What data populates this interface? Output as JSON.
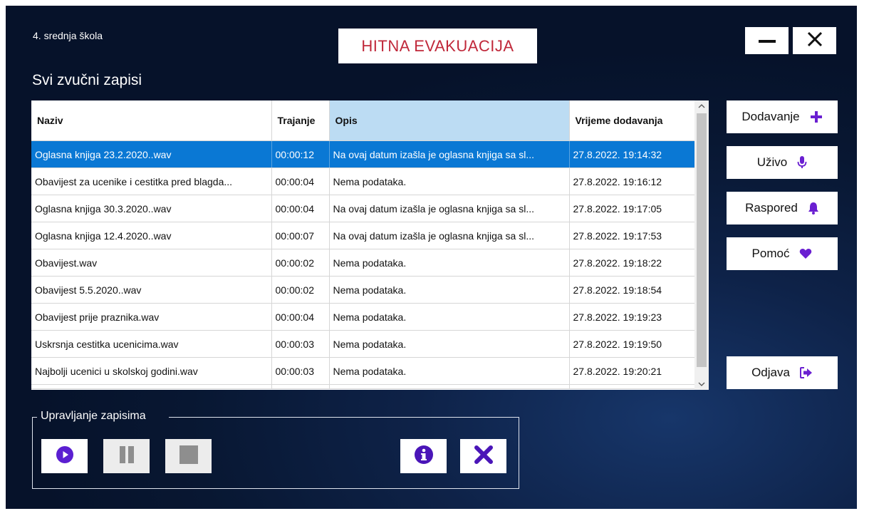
{
  "header": {
    "school_name": "4. srednja škola",
    "emergency_button": "HITNA EVAKUACIJA",
    "minimize_icon": "minimize-icon",
    "close_icon": "close-icon"
  },
  "recordings": {
    "title": "Svi zvučni zapisi",
    "columns": [
      "Naziv",
      "Trajanje",
      "Opis",
      "Vrijeme dodavanja"
    ],
    "sorted_column": "Opis",
    "rows": [
      {
        "naziv": "Oglasna knjiga 23.2.2020..wav",
        "trajanje": "00:00:12",
        "opis": "Na ovaj datum izašla je oglasna knjiga sa sl...",
        "vrijeme": "27.8.2022. 19:14:32",
        "selected": true
      },
      {
        "naziv": "Obavijest za ucenike i cestitka pred blagda...",
        "trajanje": "00:00:04",
        "opis": "Nema podataka.",
        "vrijeme": "27.8.2022. 19:16:12"
      },
      {
        "naziv": "Oglasna knjiga 30.3.2020..wav",
        "trajanje": "00:00:04",
        "opis": "Na ovaj datum izašla je oglasna knjiga sa sl...",
        "vrijeme": "27.8.2022. 19:17:05"
      },
      {
        "naziv": "Oglasna knjiga 12.4.2020..wav",
        "trajanje": "00:00:07",
        "opis": "Na ovaj datum izašla je oglasna knjiga sa sl...",
        "vrijeme": "27.8.2022. 19:17:53"
      },
      {
        "naziv": "Obavijest.wav",
        "trajanje": "00:00:02",
        "opis": "Nema podataka.",
        "vrijeme": "27.8.2022. 19:18:22"
      },
      {
        "naziv": "Obavijest 5.5.2020..wav",
        "trajanje": "00:00:02",
        "opis": "Nema podataka.",
        "vrijeme": "27.8.2022. 19:18:54"
      },
      {
        "naziv": "Obavijest prije praznika.wav",
        "trajanje": "00:00:04",
        "opis": "Nema podataka.",
        "vrijeme": "27.8.2022. 19:19:23"
      },
      {
        "naziv": "Uskrsnja cestitka ucenicima.wav",
        "trajanje": "00:00:03",
        "opis": "Nema podataka.",
        "vrijeme": "27.8.2022. 19:19:50"
      },
      {
        "naziv": "Najbolji ucenici u skolskoj godini.wav",
        "trajanje": "00:00:03",
        "opis": "Nema podataka.",
        "vrijeme": "27.8.2022. 19:20:21"
      }
    ]
  },
  "side_menu": {
    "items": [
      {
        "label": "Dodavanje",
        "icon": "plus-icon"
      },
      {
        "label": "Uživo",
        "icon": "microphone-icon"
      },
      {
        "label": "Raspored",
        "icon": "bell-icon"
      },
      {
        "label": "Pomoć",
        "icon": "heart-icon"
      }
    ],
    "logout": {
      "label": "Odjava",
      "icon": "sign-out-icon"
    }
  },
  "controls": {
    "group_label": "Upravljanje zapisima",
    "buttons": [
      {
        "name": "play",
        "icon": "play-icon",
        "enabled": true
      },
      {
        "name": "pause",
        "icon": "pause-icon",
        "enabled": false
      },
      {
        "name": "stop",
        "icon": "stop-icon",
        "enabled": false
      },
      {
        "name": "info",
        "icon": "info-icon",
        "enabled": true
      },
      {
        "name": "delete",
        "icon": "delete-x-icon",
        "enabled": true
      }
    ]
  },
  "colors": {
    "accent_purple": "#6a1fd1",
    "emergency_red": "#c0283a",
    "selection_blue": "#0a78d4",
    "sorted_header": "#bcdcf3",
    "background_navy": "#0b1d3d"
  }
}
